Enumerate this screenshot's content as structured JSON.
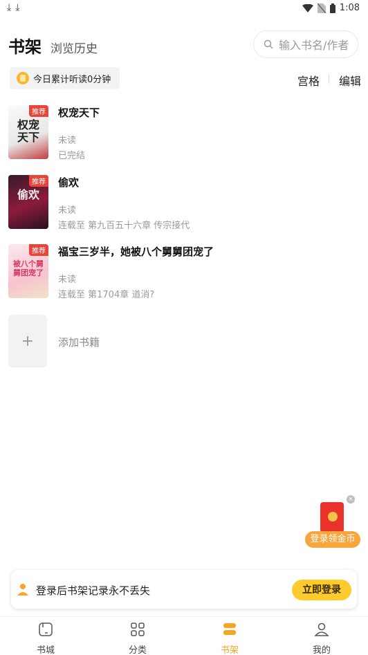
{
  "status_bar": {
    "time": "1:08"
  },
  "header": {
    "title": "书架",
    "subtitle": "浏览历史",
    "search_placeholder": "输入书名/作者"
  },
  "listen_stat": "今日累计听读0分钟",
  "toolbar": {
    "view_toggle": "宫格",
    "edit": "编辑"
  },
  "books": [
    {
      "title": "权宠天下",
      "tag": "推荐",
      "progress": "未读",
      "status": "已完结",
      "cover_text": "权宠天下"
    },
    {
      "title": "偷欢",
      "tag": "推荐",
      "progress": "未读",
      "status": "连载至 第九百五十六章 传宗接代",
      "cover_text": "偷欢"
    },
    {
      "title": "福宝三岁半，她被八个舅舅团宠了",
      "tag": "推荐",
      "progress": "未读",
      "status": "连载至 第1704章 道消?",
      "cover_text": "被八个舅舅团宠了"
    }
  ],
  "add_book": {
    "icon": "+",
    "label": "添加书籍"
  },
  "red_packet": {
    "label": "登录领金币"
  },
  "login_banner": {
    "text": "登录后书架记录永不丢失",
    "button": "立即登录"
  },
  "tabs": [
    {
      "label": "书城",
      "icon": "bookstore-icon"
    },
    {
      "label": "分类",
      "icon": "grid-icon"
    },
    {
      "label": "书架",
      "icon": "bookshelf-icon",
      "active": true
    },
    {
      "label": "我的",
      "icon": "user-icon"
    }
  ],
  "colors": {
    "accent": "#f6a623",
    "button": "#fdcc2c",
    "tag": "#e8443a"
  }
}
